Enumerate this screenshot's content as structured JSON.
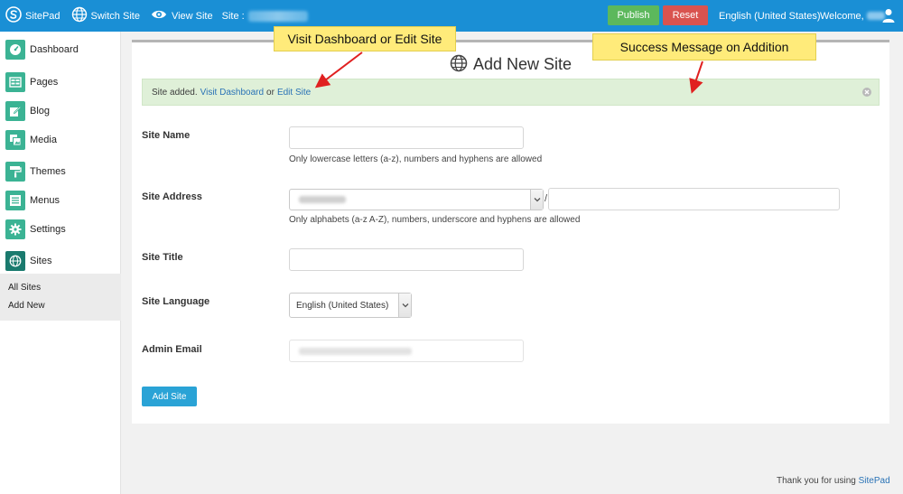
{
  "topbar": {
    "brand": "SitePad",
    "switch_site": "Switch Site",
    "view_site": "View Site",
    "site_label": "Site :",
    "publish": "Publish",
    "reset": "Reset",
    "language": "English (United States)",
    "welcome": "Welcome,",
    "icons": [
      "sitepad-logo-icon",
      "globe-icon",
      "eye-icon",
      "user-icon"
    ]
  },
  "sidebar": {
    "items": [
      {
        "label": "Dashboard",
        "icon": "dashboard-icon"
      },
      {
        "label": "Pages",
        "icon": "pages-icon"
      },
      {
        "label": "Blog",
        "icon": "blog-edit-icon"
      },
      {
        "label": "Media",
        "icon": "media-icon"
      },
      {
        "label": "Themes",
        "icon": "paint-roller-icon"
      },
      {
        "label": "Menus",
        "icon": "menu-list-icon"
      },
      {
        "label": "Settings",
        "icon": "gear-icon"
      },
      {
        "label": "Sites",
        "icon": "globe-icon"
      }
    ],
    "sub_items": [
      {
        "label": "All Sites"
      },
      {
        "label": "Add New"
      }
    ]
  },
  "main": {
    "title": "Add New Site",
    "notice": {
      "prefix": "Site added.",
      "link1": "Visit Dashboard",
      "separator": "or",
      "link2": "Edit Site"
    },
    "fields": {
      "site_name": {
        "label": "Site Name",
        "value": "",
        "hint": "Only lowercase letters (a-z), numbers and hyphens are allowed"
      },
      "site_address": {
        "label": "Site Address",
        "separator": "/",
        "value": "",
        "hint": "Only alphabets (a-z A-Z), numbers, underscore and hyphens are allowed"
      },
      "site_title": {
        "label": "Site Title",
        "value": ""
      },
      "site_language": {
        "label": "Site Language",
        "selected": "English (United States)"
      },
      "admin_email": {
        "label": "Admin Email"
      }
    },
    "submit": "Add Site"
  },
  "annotations": {
    "callout1": "Visit Dashboard or Edit Site",
    "callout2": "Success Message on Addition"
  },
  "footer": {
    "text": "Thank you for using",
    "link": "SitePad"
  },
  "colors": {
    "topbar": "#1a8fd5",
    "publish": "#5cb85c",
    "reset": "#d9534f",
    "sidebar_icon": "#3bb394",
    "notice_bg": "#dff0d8",
    "add_button": "#2aa3d6",
    "callout_bg": "#ffeb7a",
    "arrow": "#e02020"
  }
}
